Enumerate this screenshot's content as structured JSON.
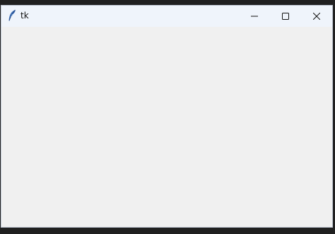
{
  "window": {
    "title": "tk",
    "app_icon": "feather-icon",
    "controls": {
      "minimize_icon": "minimize-icon",
      "maximize_icon": "maximize-icon",
      "close_icon": "close-icon"
    },
    "colors": {
      "titlebar_bg": "#eff4fb",
      "client_bg": "#f0f0f0",
      "desktop_bg": "#202020"
    }
  }
}
